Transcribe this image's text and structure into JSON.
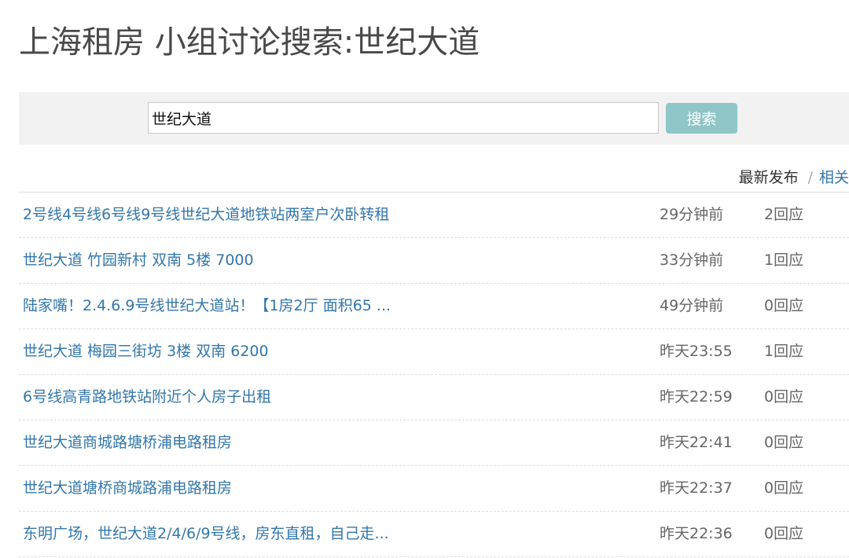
{
  "page": {
    "title": "上海租房 小组讨论搜索:世纪大道"
  },
  "search": {
    "value": "世纪大道",
    "button_label": "搜索"
  },
  "sort": {
    "latest_label": "最新发布",
    "separator": "/",
    "relevance_label": "相关"
  },
  "results": [
    {
      "title": "2号线4号线6号线9号线世纪大道地铁站两室户次卧转租",
      "time": "29分钟前",
      "replies": "2回应"
    },
    {
      "title": "世纪大道 竹园新村 双南 5楼 7000",
      "time": "33分钟前",
      "replies": "1回应"
    },
    {
      "title": "陆家嘴！2.4.6.9号线世纪大道站！【1房2厅 面积65 ...",
      "time": "49分钟前",
      "replies": "0回应"
    },
    {
      "title": "世纪大道 梅园三街坊 3楼 双南 6200",
      "time": "昨天23:55",
      "replies": "1回应"
    },
    {
      "title": "6号线高青路地铁站附近个人房子出租",
      "time": "昨天22:59",
      "replies": "0回应"
    },
    {
      "title": "世纪大道商城路塘桥浦电路租房",
      "time": "昨天22:41",
      "replies": "0回应"
    },
    {
      "title": "世纪大道塘桥商城路浦电路租房",
      "time": "昨天22:37",
      "replies": "0回应"
    },
    {
      "title": "东明广场，世纪大道2/4/6/9号线，房东直租，自己走...",
      "time": "昨天22:36",
      "replies": "0回应"
    }
  ]
}
